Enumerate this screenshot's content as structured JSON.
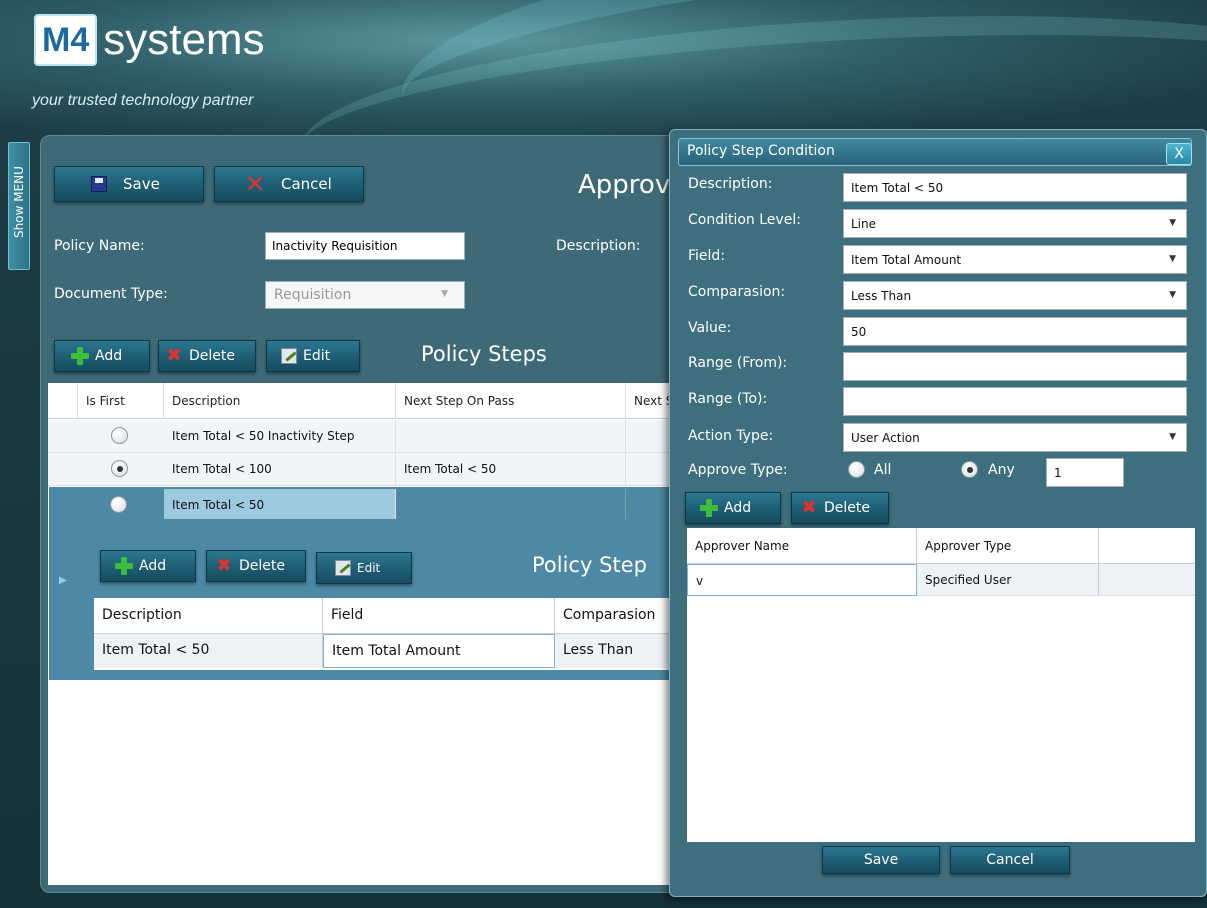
{
  "brand": {
    "logo_box": "M4",
    "logo_text": "systems",
    "tagline": "your trusted technology partner"
  },
  "show_menu": "Show MENU",
  "toolbar": {
    "save": "Save",
    "cancel": "Cancel",
    "page_title": "Approv"
  },
  "form": {
    "policy_name_label": "Policy Name:",
    "policy_name_value": "Inactivity Requisition",
    "description_label": "Description:",
    "document_type_label": "Document Type:",
    "document_type_value": "Requisition"
  },
  "steps": {
    "add": "Add",
    "delete": "Delete",
    "edit": "Edit",
    "title": "Policy Steps",
    "columns": [
      "Is First",
      "Description",
      "Next Step On Pass",
      "Next S"
    ],
    "rows": [
      {
        "is_first": false,
        "description": "Item Total < 50 Inactivity Step",
        "next_pass": ""
      },
      {
        "is_first": true,
        "description": "Item Total < 100",
        "next_pass": "Item Total < 50"
      },
      {
        "is_first": false,
        "description": "Item Total < 50",
        "next_pass": ""
      }
    ]
  },
  "conditions": {
    "add": "Add",
    "delete": "Delete",
    "edit": "Edit",
    "title": "Policy Step",
    "columns": [
      "Description",
      "Field",
      "Comparasion"
    ],
    "rows": [
      {
        "description": "Item Total < 50",
        "field": "Item Total Amount",
        "comparasion": "Less Than"
      }
    ]
  },
  "dialog": {
    "title": "Policy Step Condition",
    "close": "X",
    "description_label": "Description:",
    "description_value": "Item Total < 50",
    "condition_level_label": "Condition Level:",
    "condition_level_value": "Line",
    "field_label": "Field:",
    "field_value": "Item Total Amount",
    "comparasion_label": "Comparasion:",
    "comparasion_value": "Less Than",
    "value_label": "Value:",
    "value_value": "50",
    "range_from_label": "Range (From):",
    "range_from_value": "",
    "range_to_label": "Range (To):",
    "range_to_value": "",
    "action_type_label": "Action Type:",
    "action_type_value": "User Action",
    "approve_type_label": "Approve Type:",
    "approve_all": "All",
    "approve_any": "Any",
    "approve_selected": "Any",
    "approve_count": "1",
    "add": "Add",
    "delete": "Delete",
    "approver_columns": [
      "Approver Name",
      "Approver Type"
    ],
    "approvers": [
      {
        "name": "v",
        "type": "Specified User"
      }
    ],
    "save": "Save",
    "cancel": "Cancel"
  }
}
